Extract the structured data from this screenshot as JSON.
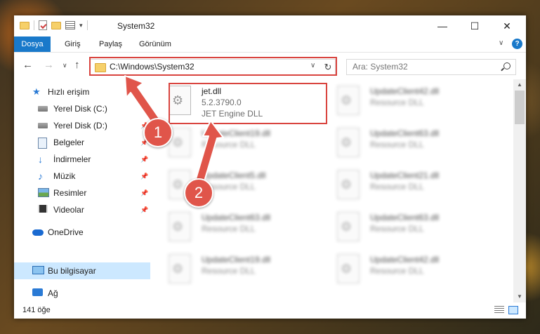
{
  "window": {
    "title": "System32",
    "controls": {
      "minimize": "—",
      "maximize": "☐",
      "close": "✕"
    }
  },
  "ribbon": {
    "tabs": [
      {
        "label": "Dosya",
        "active": true
      },
      {
        "label": "Giriş"
      },
      {
        "label": "Paylaş"
      },
      {
        "label": "Görünüm"
      }
    ],
    "collapse_glyph": "∨",
    "help_glyph": "?"
  },
  "nav": {
    "back": "←",
    "forward": "→",
    "recent": "∨",
    "up": "↑",
    "address": "C:\\Windows\\System32",
    "address_chevron": "∨",
    "refresh": "↻",
    "search_placeholder": "Ara: System32"
  },
  "sidebar": {
    "items": [
      {
        "label": "Hızlı erişim",
        "icon": "star-icon"
      },
      {
        "label": "Yerel Disk (C:)",
        "icon": "disk-icon",
        "pinned": true
      },
      {
        "label": "Yerel Disk (D:)",
        "icon": "disk-icon",
        "pinned": true
      },
      {
        "label": "Belgeler",
        "icon": "documents-icon",
        "pinned": true
      },
      {
        "label": "İndirmeler",
        "icon": "downloads-icon",
        "pinned": true
      },
      {
        "label": "Müzik",
        "icon": "music-icon",
        "pinned": true
      },
      {
        "label": "Resimler",
        "icon": "pictures-icon",
        "pinned": true
      },
      {
        "label": "Videolar",
        "icon": "videos-icon",
        "pinned": true
      },
      {
        "label": "OneDrive",
        "icon": "onedrive-icon"
      },
      {
        "label": "Bu bilgisayar",
        "icon": "this-pc-icon",
        "selected": true
      },
      {
        "label": "Ağ",
        "icon": "network-icon"
      }
    ],
    "pin_glyph": "📌"
  },
  "files": {
    "highlighted": {
      "name": "jet.dll",
      "version": "5.2.3790.0",
      "description": "JET Engine DLL"
    },
    "left_column": [
      {
        "name": "UpdateClient19.dll",
        "description": "Resource DLL"
      },
      {
        "name": "UpdateClient5.dll",
        "description": "Resource DLL"
      },
      {
        "name": "UpdateClient63.dll",
        "description": "Resource DLL"
      },
      {
        "name": "UpdateClient19.dll",
        "description": "Resource DLL"
      }
    ],
    "right_column": [
      {
        "name": "UpdateClient42.dll",
        "description": "Resource DLL"
      },
      {
        "name": "UpdateClient63.dll",
        "description": "Resource DLL"
      },
      {
        "name": "UpdateClient21.dll",
        "description": "Resource DLL"
      },
      {
        "name": "UpdateClient63.dll",
        "description": "Resource DLL"
      },
      {
        "name": "UpdateClient42.dll",
        "description": "Resource DLL"
      }
    ]
  },
  "status": {
    "item_count": "141 öğe"
  },
  "annotations": {
    "step1": "1",
    "step2": "2",
    "color": "#d9443f"
  }
}
